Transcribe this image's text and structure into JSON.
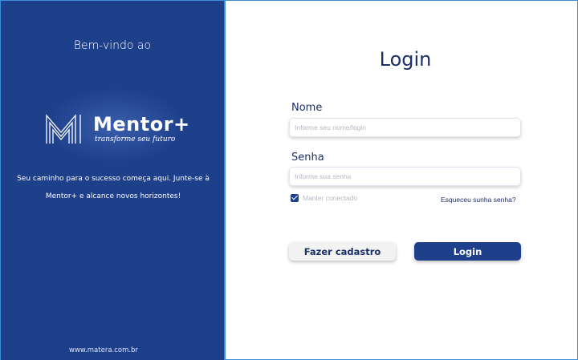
{
  "brand": {
    "welcome": "Bem-vindo ao",
    "name": "Mentor+",
    "slogan": "transforme seu futuro",
    "tagline_line1": "Seu caminho para o sucesso começa aqui. Junte-se à",
    "tagline_line2": "Mentor+ e alcance novos horizontes!",
    "url": "www.matera.com.br",
    "colors": {
      "primary": "#1e3f8a",
      "accent_border": "#3a8fd6",
      "title": "#1a2f66"
    }
  },
  "login": {
    "title": "Login",
    "name_label": "Nome",
    "name_placeholder": "Informe seu nome/login",
    "password_label": "Senha",
    "password_placeholder": "Informe sua senha",
    "keep_connected": "Manter conectado",
    "keep_connected_checked": true,
    "forgot_password": "Esqueceu sunha senha?",
    "register_button": "Fazer cadastro",
    "login_button": "Login"
  }
}
